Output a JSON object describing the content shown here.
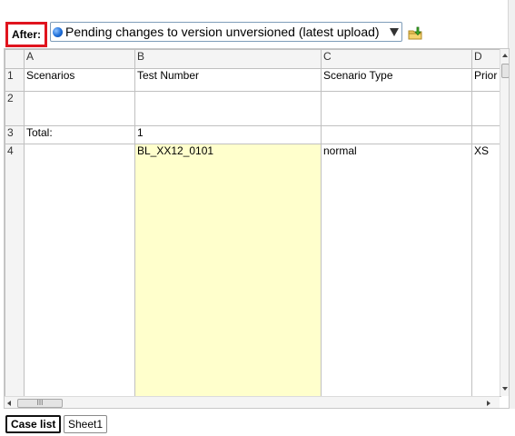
{
  "header": {
    "after_label": "After:",
    "version_select_value": "Pending changes to version unversioned (latest upload)"
  },
  "sheet": {
    "column_headers": [
      "A",
      "B",
      "C",
      "D"
    ],
    "rows": [
      {
        "num": "1",
        "cells": [
          "Scenarios",
          "Test Number",
          "Scenario Type",
          "Prior"
        ]
      },
      {
        "num": "2",
        "cells": [
          "",
          "",
          "",
          ""
        ]
      },
      {
        "num": "3",
        "cells": [
          "Total:",
          "1",
          "",
          ""
        ]
      },
      {
        "num": "4",
        "cells": [
          "",
          "BL_XX12_0101",
          "normal",
          "XS"
        ]
      }
    ],
    "highlight_color": "#ffffcc"
  },
  "scrollbar": {
    "h_thumb_grip": "III"
  },
  "tabs": [
    {
      "label": "Case list",
      "active": true
    },
    {
      "label": "Sheet1",
      "active": false
    }
  ],
  "colors": {
    "after_border": "#e0141e",
    "status_dot": "#1e6fd9"
  },
  "icons": {
    "status": "blue-dot-icon",
    "upload": "export-folder-icon"
  }
}
